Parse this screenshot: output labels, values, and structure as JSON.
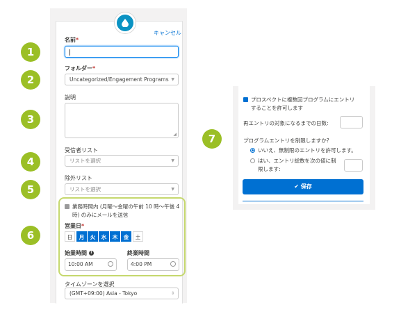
{
  "colors": {
    "badge": "#9bbf26",
    "brand": "#0070d2",
    "drop": "#0b93c3",
    "highlight_border": "#c5d86d"
  },
  "badges": [
    "1",
    "2",
    "3",
    "4",
    "5",
    "6",
    "7"
  ],
  "form": {
    "icon": "water-drop-icon",
    "cancel_label": "キャンセル",
    "name_label": "名前",
    "name_value": "",
    "folder_label": "フォルダー",
    "folder_value": "Uncategorized/Engagement Programs",
    "description_label": "説明",
    "recipients_label": "受信者リスト",
    "recipients_placeholder": "リストを選択",
    "exclusion_label": "除外リスト",
    "exclusion_placeholder": "リストを選択",
    "business_hours_text_1": "業務時間内 (月曜～金曜の午前 10 時～午後 4",
    "business_hours_text_2": "時) のみにメールを送信",
    "business_days_label": "営業日",
    "days": [
      {
        "label": "日",
        "on": false
      },
      {
        "label": "月",
        "on": true
      },
      {
        "label": "火",
        "on": true
      },
      {
        "label": "水",
        "on": true
      },
      {
        "label": "木",
        "on": true
      },
      {
        "label": "金",
        "on": true
      },
      {
        "label": "土",
        "on": false
      }
    ],
    "start_label": "始業時間",
    "start_value": "10:00 AM",
    "end_label": "終業時間",
    "end_value": "4:00 PM",
    "timezone_label": "タイムゾーンを選択",
    "timezone_value": "(GMT+09:00) Asia - Tokyo"
  },
  "reentry": {
    "allow_text_1": "プロスペクトに複数回プログラムにエントリ",
    "allow_text_2": "することを許可します",
    "days_label": "再エントリの対象になるまでの日数:",
    "limit_question": "プログラムエントリを制限しますか?",
    "option_no": "いいえ、無制限のエントリを許可します。",
    "option_yes_1": "はい、エントリ総数を次の値に制",
    "option_yes_2": "限します:",
    "save_label": "✔ 保存"
  }
}
